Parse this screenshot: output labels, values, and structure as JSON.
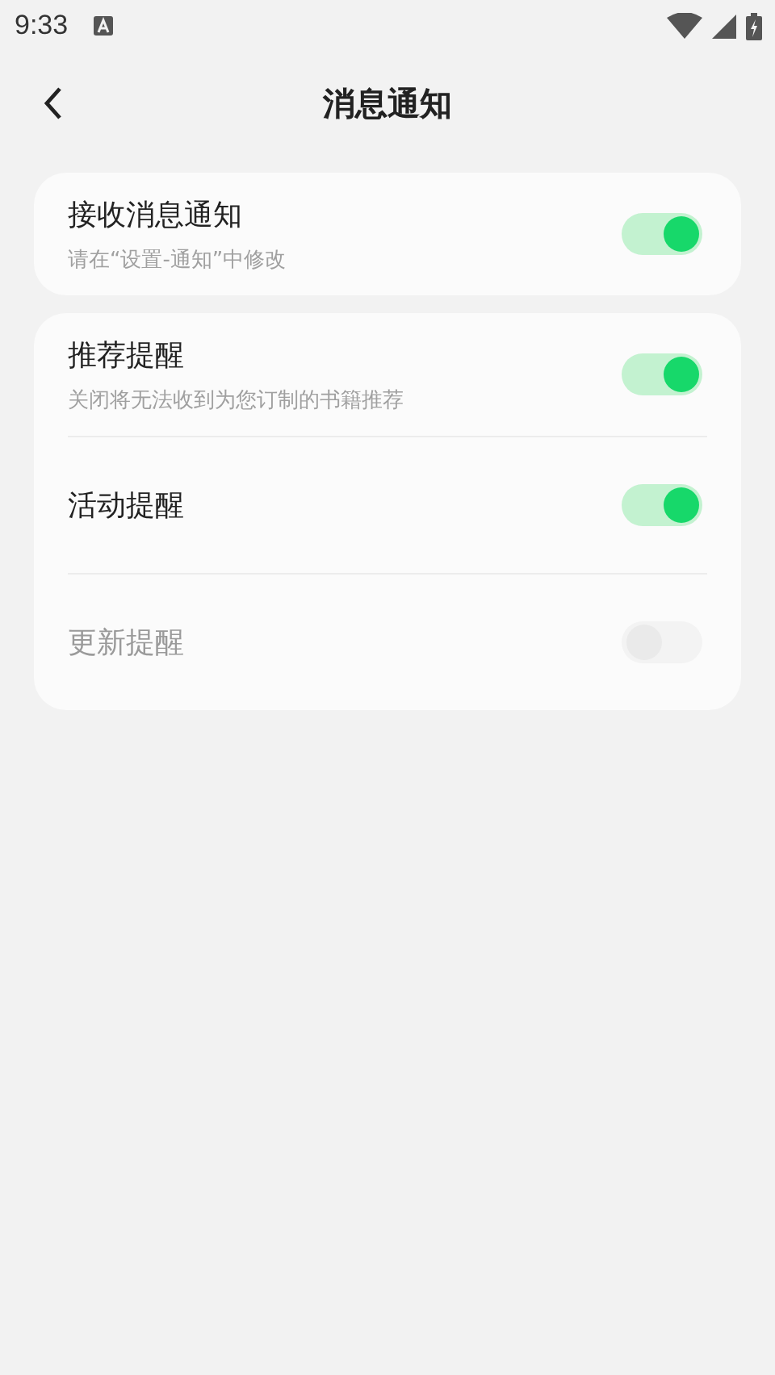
{
  "status_bar": {
    "time": "9:33"
  },
  "header": {
    "title": "消息通知"
  },
  "cards": [
    {
      "items": [
        {
          "title": "接收消息通知",
          "subtitle": "请在“设置-通知”中修改",
          "on": true,
          "disabled": false
        }
      ]
    },
    {
      "items": [
        {
          "title": "推荐提醒",
          "subtitle": "关闭将无法收到为您订制的书籍推荐",
          "on": true,
          "disabled": false
        },
        {
          "title": "活动提醒",
          "on": true,
          "disabled": false
        },
        {
          "title": "更新提醒",
          "on": false,
          "disabled": true
        }
      ]
    }
  ]
}
